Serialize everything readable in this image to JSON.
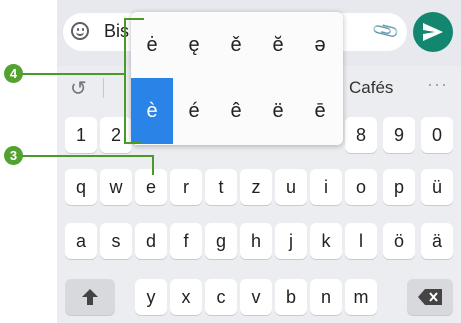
{
  "input": {
    "typed_text": "Bis"
  },
  "suggestions": {
    "word": "Cafés",
    "more": "···"
  },
  "accent_popup": {
    "row1": [
      "ė",
      "ę",
      "ě",
      "ĕ",
      "ə"
    ],
    "row2": [
      "è",
      "é",
      "ê",
      "ë",
      "ē"
    ],
    "selected": "è"
  },
  "keyboard": {
    "row_numbers": [
      "1",
      "2",
      "8",
      "9",
      "0"
    ],
    "row_q": [
      "q",
      "w",
      "e",
      "r",
      "t",
      "z",
      "u",
      "i",
      "o",
      "p",
      "ü"
    ],
    "row_a": [
      "a",
      "s",
      "d",
      "f",
      "g",
      "h",
      "j",
      "k",
      "l",
      "ö",
      "ä"
    ],
    "row_y": [
      "y",
      "x",
      "c",
      "v",
      "b",
      "n",
      "m"
    ]
  },
  "callouts": {
    "four": "4",
    "three": "3"
  },
  "colors": {
    "send_button": "#12866f",
    "selected_accent": "#2a83e6",
    "callout": "#53a22f"
  }
}
